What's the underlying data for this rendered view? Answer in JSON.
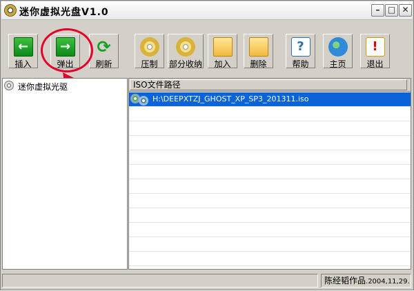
{
  "window": {
    "title": "迷你虚拟光盘V1.0"
  },
  "toolbar": [
    {
      "id": "insert",
      "label": "插入",
      "icon": "green-arrow-left-icon"
    },
    {
      "id": "eject",
      "label": "弹出",
      "icon": "green-arrow-right-icon"
    },
    {
      "id": "refresh",
      "label": "刷新",
      "icon": "refresh-icon"
    },
    {
      "id": "compress",
      "label": "压制",
      "icon": "cd-icon"
    },
    {
      "id": "partial",
      "label": "部分收纳",
      "icon": "cd-pieces-icon"
    },
    {
      "id": "add",
      "label": "加入",
      "icon": "folder-add-icon"
    },
    {
      "id": "delete",
      "label": "删除",
      "icon": "folder-delete-icon"
    },
    {
      "id": "help",
      "label": "帮助",
      "icon": "help-icon"
    },
    {
      "id": "home",
      "label": "主页",
      "icon": "globe-home-icon"
    },
    {
      "id": "exit",
      "label": "退出",
      "icon": "exit-icon"
    }
  ],
  "tree": {
    "root_label": "迷你虚拟光驱"
  },
  "list": {
    "column_header": "ISO文件路径",
    "rows": [
      {
        "path": "H:\\DEEPXTZJ_GHOST_XP_SP3_201311.iso",
        "selected": true
      }
    ]
  },
  "status": {
    "author": "陈经韬作品",
    "date": ".2004,11,29."
  },
  "colors": {
    "selection": "#0a64d8",
    "highlight_ring": "#e4002b"
  }
}
